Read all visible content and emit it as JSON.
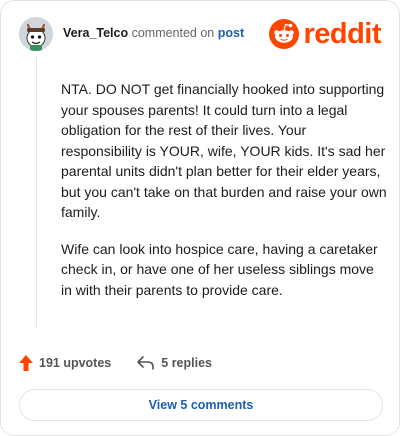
{
  "header": {
    "username": "Vera_Telco",
    "commented_on_text": "commented on",
    "post_link": "post",
    "brand_name": "reddit"
  },
  "comment": {
    "paragraphs": [
      "NTA. DO NOT get financially hooked into supporting your spouses parents! It could turn into a legal obligation for the rest of their lives. Your responsibility is YOUR, wife, YOUR kids. It's sad her parental units didn't plan better for their elder years, but you can't take on that burden and raise your own family.",
      "Wife can look into hospice care, having a caretaker check in, or have one of her useless siblings move in with their parents to provide care."
    ]
  },
  "actions": {
    "upvotes": "191 upvotes",
    "replies": "5 replies"
  },
  "view_button": "View 5 comments",
  "colors": {
    "brand": "#ff4500",
    "link": "#1a5fb4",
    "text": "#1c1c1c",
    "muted": "#555555",
    "border": "#e3e3e3"
  },
  "icons": {
    "avatar": "snoo-avatar",
    "logo": "reddit-snoo-icon",
    "upvote": "upvote-arrow-icon",
    "reply": "reply-arrow-icon"
  }
}
